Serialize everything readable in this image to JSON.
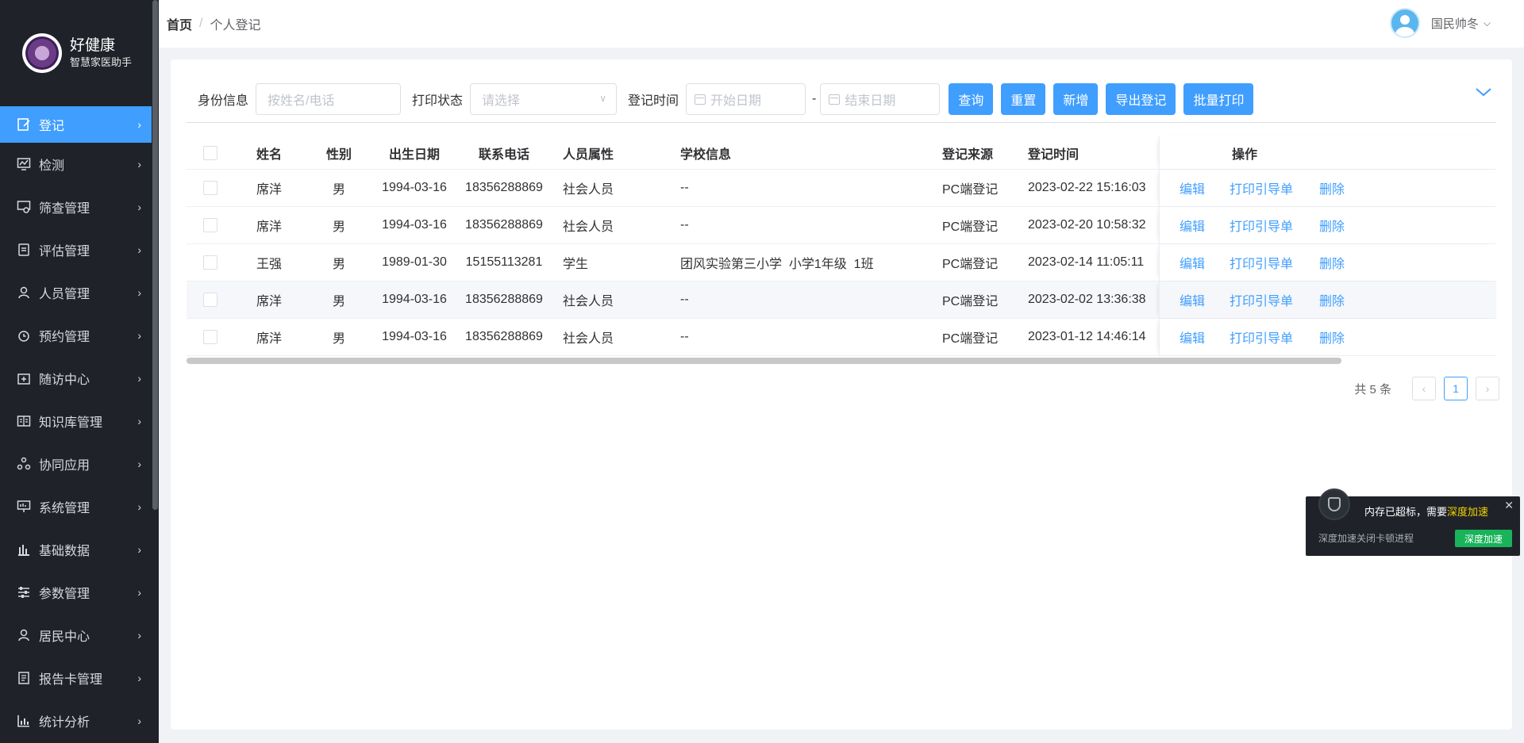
{
  "brand": {
    "title": "好健康",
    "subtitle": "智慧家医助手"
  },
  "sidebar": {
    "items": [
      {
        "label": "登记",
        "icon": "edit-icon",
        "active": true
      },
      {
        "label": "检测",
        "icon": "chart-monitor-icon"
      },
      {
        "label": "筛查管理",
        "icon": "screen-icon"
      },
      {
        "label": "评估管理",
        "icon": "clipboard-icon"
      },
      {
        "label": "人员管理",
        "icon": "user-icon"
      },
      {
        "label": "预约管理",
        "icon": "alarm-clock-icon"
      },
      {
        "label": "随访中心",
        "icon": "medical-kit-icon"
      },
      {
        "label": "知识库管理",
        "icon": "book-icon"
      },
      {
        "label": "协同应用",
        "icon": "share-nodes-icon"
      },
      {
        "label": "系统管理",
        "icon": "presentation-icon"
      },
      {
        "label": "基础数据",
        "icon": "bar-chart-icon"
      },
      {
        "label": "参数管理",
        "icon": "sliders-icon"
      },
      {
        "label": "居民中心",
        "icon": "user-icon"
      },
      {
        "label": "报告卡管理",
        "icon": "report-icon"
      },
      {
        "label": "统计分析",
        "icon": "stats-icon"
      }
    ]
  },
  "header": {
    "breadcrumb": {
      "home": "首页",
      "separator": "/",
      "current": "个人登记"
    },
    "user": {
      "name": "国民帅冬"
    }
  },
  "filters": {
    "identity_label": "身份信息",
    "identity_placeholder": "按姓名/电话",
    "print_status_label": "打印状态",
    "print_status_placeholder": "请选择",
    "reg_time_label": "登记时间",
    "start_date_placeholder": "开始日期",
    "range_separator": "-",
    "end_date_placeholder": "结束日期",
    "buttons": {
      "query": "查询",
      "reset": "重置",
      "add": "新增",
      "export": "导出登记",
      "batch_print": "批量打印"
    }
  },
  "table": {
    "columns": {
      "name": "姓名",
      "sex": "性别",
      "birth": "出生日期",
      "phone": "联系电话",
      "attr": "人员属性",
      "school": "学校信息",
      "source": "登记来源",
      "time": "登记时间",
      "ops": "操作"
    },
    "ops": {
      "edit": "编辑",
      "print": "打印引导单",
      "delete": "删除"
    },
    "rows": [
      {
        "name": "席洋",
        "sex": "男",
        "birth": "1994-03-16",
        "phone": "18356288869",
        "attr": "社会人员",
        "school": "--",
        "source": "PC端登记",
        "time": "2023-02-22 15:16:03"
      },
      {
        "name": "席洋",
        "sex": "男",
        "birth": "1994-03-16",
        "phone": "18356288869",
        "attr": "社会人员",
        "school": "--",
        "source": "PC端登记",
        "time": "2023-02-20 10:58:32"
      },
      {
        "name": "王强",
        "sex": "男",
        "birth": "1989-01-30",
        "phone": "15155113281",
        "attr": "学生",
        "school": "团风实验第三小学  小学1年级  1班",
        "source": "PC端登记",
        "time": "2023-02-14 11:05:11"
      },
      {
        "name": "席洋",
        "sex": "男",
        "birth": "1994-03-16",
        "phone": "18356288869",
        "attr": "社会人员",
        "school": "--",
        "source": "PC端登记",
        "time": "2023-02-02 13:36:38"
      },
      {
        "name": "席洋",
        "sex": "男",
        "birth": "1994-03-16",
        "phone": "18356288869",
        "attr": "社会人员",
        "school": "--",
        "source": "PC端登记",
        "time": "2023-01-12 14:46:14"
      }
    ]
  },
  "pagination": {
    "total_text": "共 5 条",
    "current_page": "1"
  },
  "toast": {
    "message_prefix": "内存已超标，需要",
    "message_highlight": "深度加速",
    "sub_text": "深度加速关闭卡顿进程",
    "button": "深度加速"
  },
  "colors": {
    "primary": "#409eff",
    "sidebar_bg": "#1f2329",
    "toast_button": "#19b35a"
  }
}
